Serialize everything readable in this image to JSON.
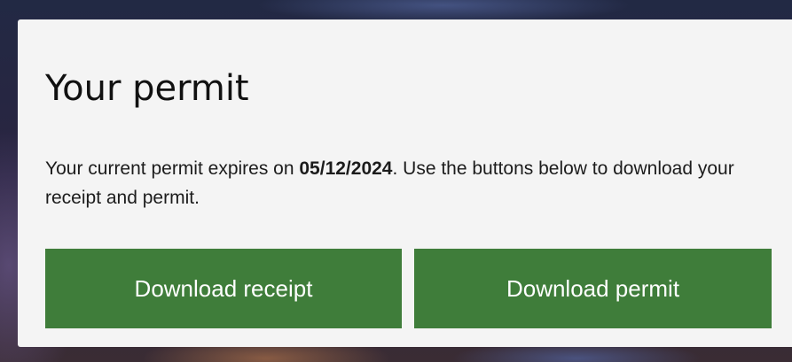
{
  "permit_card": {
    "title": "Your permit",
    "description_before": "Your current permit expires on ",
    "expiry_date": "05/12/2024",
    "description_after": ". Use the buttons below to download your receipt and permit.",
    "download_receipt_label": "Download receipt",
    "download_permit_label": "Download permit"
  },
  "colors": {
    "button_green": "#3f7d3a",
    "card_background": "#f4f4f4"
  }
}
